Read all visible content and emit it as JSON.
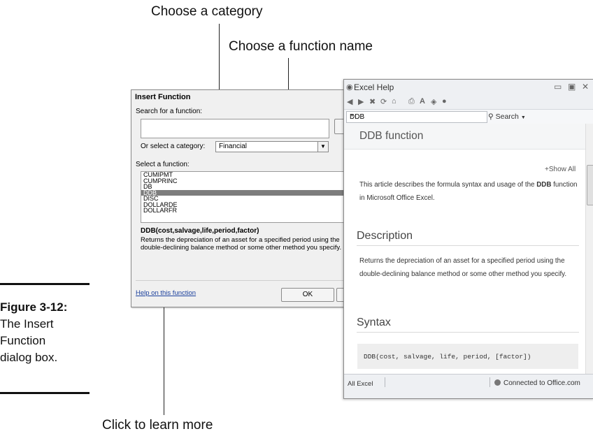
{
  "callouts": {
    "category": "Choose a category",
    "function_name": "Choose a function name",
    "learn_more": "Click to learn more"
  },
  "figure": {
    "number": "Figure 3-12:",
    "caption_lines": [
      "The Insert",
      "Function",
      "dialog box."
    ]
  },
  "insert_function": {
    "title": "Insert Function",
    "search_label": "Search for a function:",
    "search_value": "",
    "category_label": "Or select a category:",
    "category_value": "Financial",
    "function_label": "Select a function:",
    "functions": [
      "CUMIPMT",
      "CUMPRINC",
      "DB",
      "DDB",
      "DISC",
      "DOLLARDE",
      "DOLLARFR"
    ],
    "selected_function": "DDB",
    "syntax": "DDB(cost,salvage,life,period,factor)",
    "description": "Returns the depreciation of an asset for a specified period using the double-declining balance method or some other method you specify.",
    "help_link": "Help on this function",
    "ok_label": "OK"
  },
  "excel_help": {
    "window_title": "Excel Help",
    "search_value": "DDB",
    "search_button": "Search",
    "heading": "DDB function",
    "show_all": "+Show All",
    "intro_pre": "This article describes the formula syntax and usage of the ",
    "intro_bold": "DDB",
    "intro_post": " function in Microsoft Office Excel.",
    "description_heading": "Description",
    "description_text": "Returns the depreciation of an asset for a specified period using the double-declining balance method or some other method you specify.",
    "syntax_heading": "Syntax",
    "syntax_code": "DDB(cost, salvage, life, period, [factor])",
    "status_left": "All Excel",
    "status_right": "Connected to Office.com"
  }
}
